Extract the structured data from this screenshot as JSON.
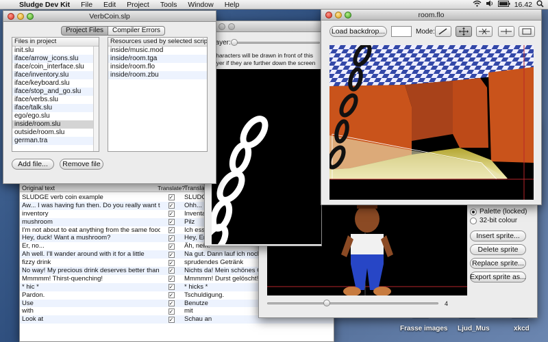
{
  "menubar": {
    "app_name": "Sludge Dev Kit",
    "items": [
      "File",
      "Edit",
      "Project",
      "Tools",
      "Window",
      "Help"
    ],
    "clock": "16.42"
  },
  "desktop": {
    "icons": [
      "Frasse images",
      "Ljud_Mus",
      "xkcd"
    ]
  },
  "project_window": {
    "title": "VerbCoin.slp",
    "tabs": [
      "Project Files",
      "Compiler Errors"
    ],
    "files_header": "Files in project",
    "files": [
      "init.slu",
      "iface/arrow_icons.slu",
      "iface/coin_interface.slu",
      "iface/inventory.slu",
      "iface/keyboard.slu",
      "iface/stop_and_go.slu",
      "iface/verbs.slu",
      "iface/talk.slu",
      "ego/ego.slu",
      "inside/room.slu",
      "outside/room.slu",
      "german.tra"
    ],
    "selected_file_index": 9,
    "resources_header": "Resources used by selected script",
    "resources": [
      "inside/music.mod",
      "inside/room.tga",
      "inside/room.flo",
      "inside/room.zbu"
    ],
    "add_button": "Add file...",
    "remove_button": "Remove file"
  },
  "translation_window": {
    "headers": [
      "Original text",
      "Translate?",
      "Translation"
    ],
    "rows": [
      [
        "SLUDGE verb coin example",
        "SLUDGE V"
      ],
      [
        "Aw... I was having fun then. Do you really want to",
        "Ohh... Es"
      ],
      [
        "inventory",
        "Inventar"
      ],
      [
        "mushroom",
        "Pilz"
      ],
      [
        "I'm not about to eat anything from the same food-",
        "Ich esse s"
      ],
      [
        "Hey, duck! Want a mushroom?",
        "Hey, Ente"
      ],
      [
        "Er, no...",
        "Äh, nein."
      ],
      [
        "Ah well. I'll wander around with it for a little",
        "Na gut. Dann lauf ich noch eine"
      ],
      [
        "fizzy drink",
        "sprudendes Getränk"
      ],
      [
        "No way! My precious drink deserves better than",
        "Nichts da! Mein schönes Geträn"
      ],
      [
        "Mmmmm! Thirst-quenching!",
        "Mmmmm! Durst gelöscht!"
      ],
      [
        "* hic *",
        "* hicks *"
      ],
      [
        "Pardon.",
        "Tschuldigung."
      ],
      [
        "Use",
        "Benutze"
      ],
      [
        "with",
        "mit"
      ],
      [
        "Look at",
        "Schau an"
      ]
    ]
  },
  "zbuffer_window": {
    "layer_label": "Layer:",
    "description": "Characters will be drawn in front of this layer if they are further down the screen than:"
  },
  "sprite_window": {
    "slider_value": "4",
    "palette_options": [
      "Palette (locked)",
      "32-bit colour"
    ],
    "selected_palette_index": 0,
    "buttons": [
      "Insert sprite...",
      "Delete sprite",
      "Replace sprite...",
      "Export sprite as..."
    ]
  },
  "floor_window": {
    "title": "room.flo",
    "load_button": "Load backdrop...",
    "mode_label": "Mode:"
  },
  "colors": {
    "selection": "#d4d4d4",
    "alt_row": "#edf3fe",
    "backdrop_wall": "#c9531b",
    "backdrop_floor": "#e8e08a"
  }
}
